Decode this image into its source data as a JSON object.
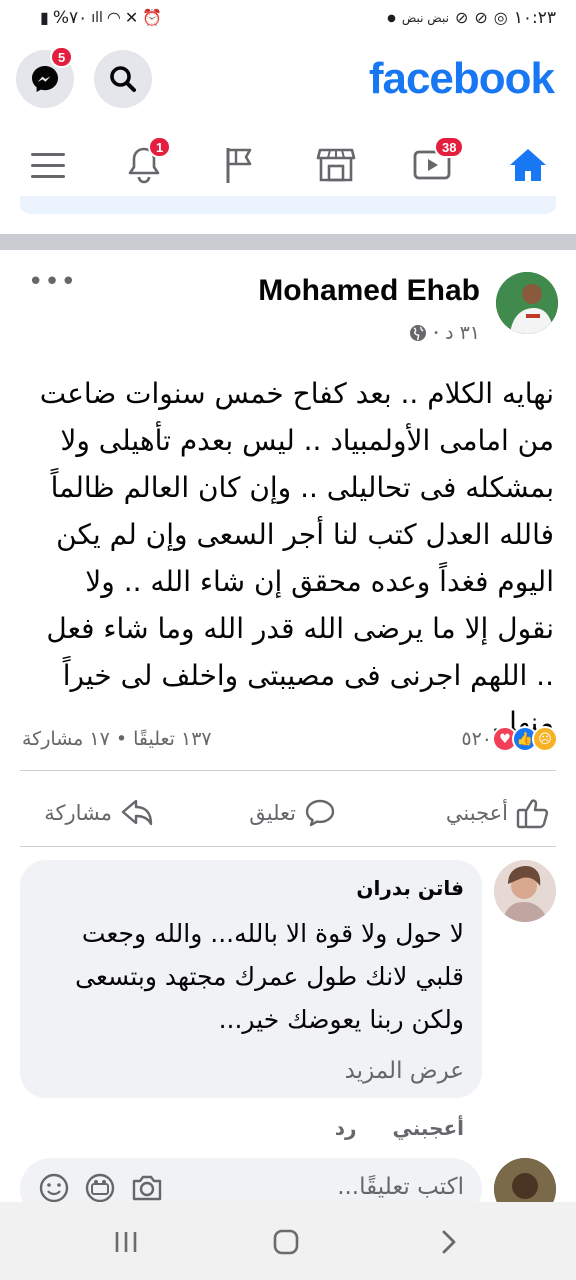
{
  "status_bar": {
    "time": "١٠:٢٣",
    "battery": "%٧٠",
    "notification_text": "نبض نبض"
  },
  "header": {
    "logo": "facebook",
    "messenger_badge": "5"
  },
  "nav": {
    "notifications_badge": "1",
    "watch_badge": "38"
  },
  "post": {
    "author": "Mohamed Ehab",
    "time": "٣١ د",
    "text": "نهايه الكلام .. بعد كفاح خمس سنوات ضاعت من امامى الأولمبياد .. ليس بعدم تأهيلى ولا بمشكله فى تحاليلى .. وإن كان العالم ظالماً فالله العدل كتب لنا أجر السعى وإن لم يكن اليوم فغداً وعده محقق إن شاء الله .. ولا نقول إلا ما يرضى الله قدر الله وما شاء فعل .. اللهم اجرنى فى مصيبتى واخلف لى خيراً منها .",
    "reaction_count": "٥٢٠",
    "comments_shares": "١٣٧ تعليقًا • ١٧ مشاركة",
    "actions": {
      "like": "أعجبني",
      "comment": "تعليق",
      "share": "مشاركة"
    }
  },
  "comment": {
    "name": "فاتن بدران",
    "text": "لا حول ولا قوة الا بالله... والله وجعت قلبي لانك طول عمرك مجتهد وبتسعى ولكن ربنا يعوضك خير...",
    "see_more": "عرض المزيد",
    "like": "أعجبني",
    "reply": "رد"
  },
  "write_comment": {
    "placeholder": "اكتب تعليقًا..."
  },
  "colors": {
    "brand": "#1877f2",
    "badge": "#e41e3f",
    "secondary_text": "#65676b",
    "bubble": "#f0f2f5"
  },
  "icons": [
    "messenger-icon",
    "search-icon",
    "menu-icon",
    "bell-icon",
    "flag-icon",
    "marketplace-icon",
    "watch-icon",
    "home-icon",
    "globe-icon",
    "like-icon",
    "comment-icon",
    "share-icon",
    "camera-icon",
    "gif-icon",
    "emoji-icon"
  ]
}
